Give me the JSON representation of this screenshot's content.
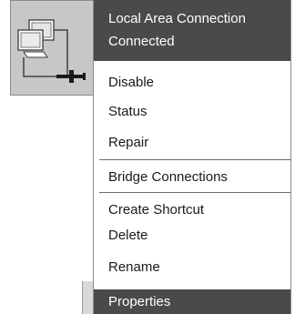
{
  "header": {
    "title": "Local Area Connection",
    "status": "Connected"
  },
  "menu": {
    "items": [
      "Disable",
      "Status",
      "Repair",
      "Bridge Connections",
      "Create Shortcut",
      "Delete",
      "Rename",
      "Properties"
    ],
    "highlighted": "Properties"
  },
  "icon": {
    "name": "network-connection-icon"
  },
  "colors": {
    "header_bg": "#4a4a4a",
    "highlight_bg": "#4a4a4a",
    "icon_bg": "#c7c7c7"
  }
}
